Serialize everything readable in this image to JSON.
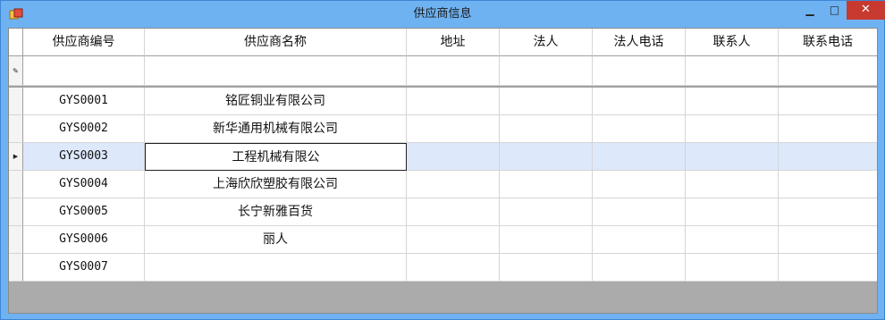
{
  "window": {
    "title": "供应商信息",
    "controls": {
      "minimize": "▁",
      "maximize": "□",
      "close": "✕"
    }
  },
  "grid": {
    "columns": [
      {
        "label": "供应商编号"
      },
      {
        "label": "供应商名称"
      },
      {
        "label": "地址"
      },
      {
        "label": "法人"
      },
      {
        "label": "法人电话"
      },
      {
        "label": "联系人"
      },
      {
        "label": "联系电话"
      }
    ],
    "new_row_marker": "✎",
    "current_row_marker": "▶",
    "rows": [
      {
        "code": "GYS0001",
        "name": "铭匠铜业有限公司",
        "address": "",
        "legal": "",
        "legal_phone": "",
        "contact": "",
        "contact_phone": ""
      },
      {
        "code": "GYS0002",
        "name": "新华通用机械有限公司",
        "address": "",
        "legal": "",
        "legal_phone": "",
        "contact": "",
        "contact_phone": ""
      },
      {
        "code": "GYS0003",
        "name": "工程机械有限公",
        "address": "",
        "legal": "",
        "legal_phone": "",
        "contact": "",
        "contact_phone": ""
      },
      {
        "code": "GYS0004",
        "name": "上海欣欣塑胶有限公司",
        "address": "",
        "legal": "",
        "legal_phone": "",
        "contact": "",
        "contact_phone": ""
      },
      {
        "code": "GYS0005",
        "name": "长宁新雅百货",
        "address": "",
        "legal": "",
        "legal_phone": "",
        "contact": "",
        "contact_phone": ""
      },
      {
        "code": "GYS0006",
        "name": "丽人",
        "address": "",
        "legal": "",
        "legal_phone": "",
        "contact": "",
        "contact_phone": ""
      },
      {
        "code": "GYS0007",
        "name": "",
        "address": "",
        "legal": "",
        "legal_phone": "",
        "contact": "",
        "contact_phone": ""
      }
    ],
    "selected_row": 2
  },
  "colors": {
    "title_bar": "#6fb2f2",
    "close_button": "#c83a30",
    "selection": "#dde8fb"
  }
}
